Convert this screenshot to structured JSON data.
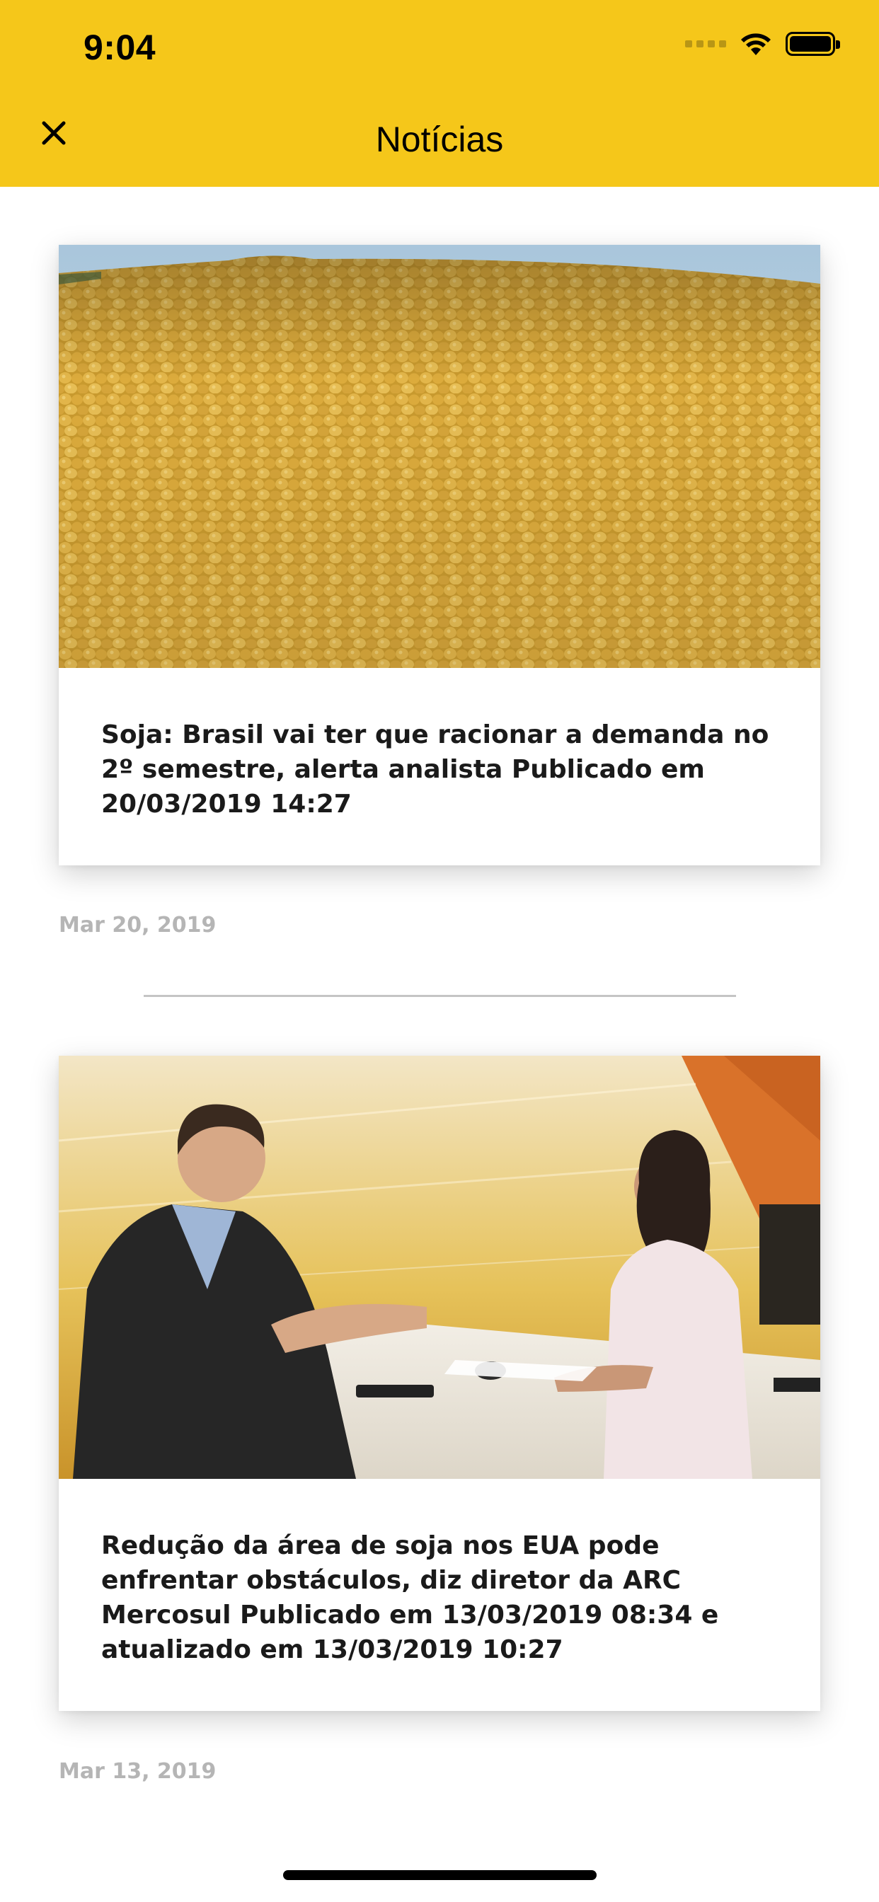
{
  "status_bar": {
    "time": "9:04"
  },
  "header": {
    "title": "Notícias",
    "close_icon": "close-icon"
  },
  "articles": [
    {
      "headline": "Soja: Brasil vai ter que racionar a demanda no 2º semestre, alerta analista Publicado em 20/03/2019 14:27",
      "date": "Mar 20, 2019",
      "image": "soybeans-pile"
    },
    {
      "headline": "Redução da área de soja nos EUA pode enfrentar obstáculos, diz diretor da ARC Mercosul Publicado em 13/03/2019 08:34 e atualizado em 13/03/2019 10:27",
      "date": "Mar 13, 2019",
      "image": "interview-studio"
    }
  ],
  "colors": {
    "header_bg": "#F5C71A",
    "date_text": "#b5b5b5"
  }
}
